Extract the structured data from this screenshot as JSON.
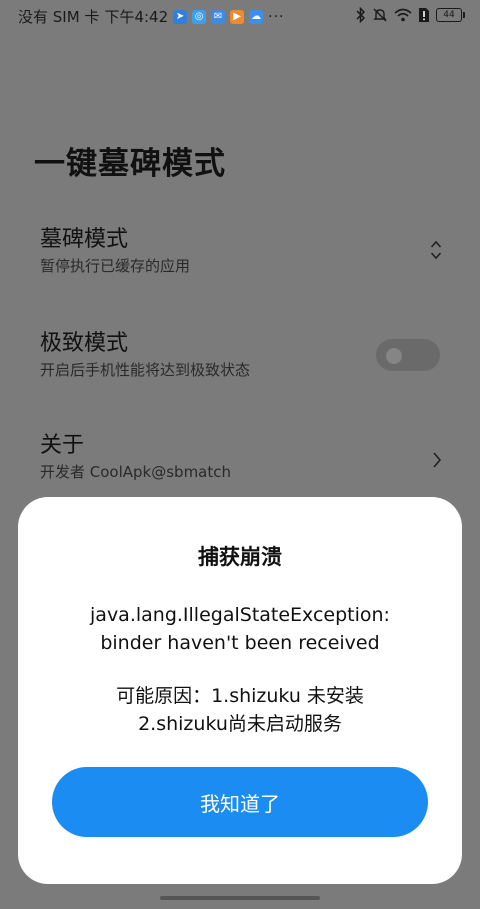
{
  "status_bar": {
    "carrier": "没有 SIM 卡",
    "time": "下午4:42",
    "more": "···",
    "battery": "44",
    "app_icons": [
      {
        "name": "location-app-icon",
        "color": "#2f7fe0",
        "glyph": "➤"
      },
      {
        "name": "browser-app-icon",
        "color": "#3aa0f0",
        "glyph": "◎"
      },
      {
        "name": "mail-app-icon",
        "color": "#3c8de0",
        "glyph": "✉"
      },
      {
        "name": "video-app-icon",
        "color": "#f08a2a",
        "glyph": "▶"
      },
      {
        "name": "cloud-app-icon",
        "color": "#3a8ff0",
        "glyph": "☁"
      }
    ],
    "right_icons": [
      "bluetooth-icon",
      "mute-icon",
      "wifi-icon",
      "sim-alert-icon",
      "battery-icon"
    ]
  },
  "page": {
    "title": "一键墓碑模式",
    "items": [
      {
        "title": "墓碑模式",
        "subtitle": "暂停执行已缓存的应用",
        "control": "updown-icon"
      },
      {
        "title": "极致模式",
        "subtitle": "开启后手机性能将达到极致状态",
        "control": "toggle",
        "toggle_on": false
      },
      {
        "title": "关于",
        "subtitle": "开发者 CoolApk@sbmatch",
        "control": "chevron-right-icon"
      }
    ]
  },
  "dialog": {
    "title": "捕获崩溃",
    "message_lines": [
      "java.lang.IllegalStateException:",
      "binder haven't been received"
    ],
    "reason_lines": [
      "可能原因：1.shizuku 未安装",
      "2.shizuku尚未启动服务"
    ],
    "button_label": "我知道了"
  },
  "colors": {
    "overlay": "#7b7b7b",
    "dialog_bg": "#ffffff",
    "button": "#1a8cf2"
  }
}
